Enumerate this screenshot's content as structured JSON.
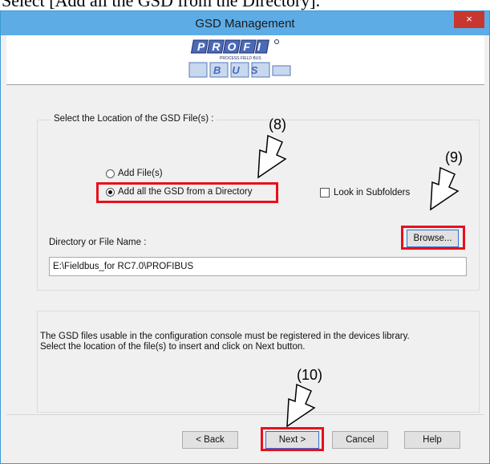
{
  "caption": "Select [Add all the GSD from the Directory].",
  "window": {
    "title": "GSD Management",
    "close_icon": "×"
  },
  "logo": {
    "top_text": "PROFI",
    "sub_text": "PROCESS FIELD BUS",
    "bottom_text": "BUS"
  },
  "group": {
    "legend": "Select the Location of the GSD File(s) :",
    "radio_add_files": "Add File(s)",
    "radio_add_directory": "Add all the GSD from a Directory",
    "selected": "Add all the GSD from a Directory",
    "checkbox_subfolders": "Look in Subfolders",
    "dir_label": "Directory or File Name :",
    "browse_label": "Browse...",
    "dir_value": "E:\\Fieldbus_for RC7.0\\PROFIBUS"
  },
  "info": {
    "line1": "The GSD files usable in the configuration console must be registered in the devices library.",
    "line2": "Select the location of the file(s) to insert and click on Next button."
  },
  "footer": {
    "back": "< Back",
    "next": "Next >",
    "cancel": "Cancel",
    "help": "Help"
  },
  "annotations": {
    "step8": "(8)",
    "step9": "(9)",
    "step10": "(10)"
  },
  "colors": {
    "highlight": "#e8101c",
    "titlebar": "#5dace6",
    "close": "#c7372f"
  }
}
